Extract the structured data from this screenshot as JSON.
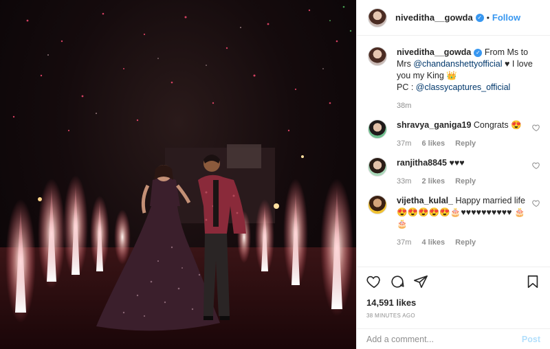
{
  "post": {
    "username": "niveditha__gowda",
    "follow_label": "Follow",
    "dot": "•",
    "caption": {
      "before": "From Ms to Mrs",
      "mention1": "@chandanshetty",
      "mention1b": "official",
      "after": "♥ I love you my King 👑",
      "pc": "PC : ",
      "mention2": "@classycaptures_official",
      "time": "38m"
    },
    "comments": [
      {
        "user": "shravya_ganiga19",
        "text": "Congrats 😍",
        "time": "37m",
        "likes": "6 likes",
        "reply": "Reply"
      },
      {
        "user": "ranjitha8845",
        "text": "♥♥♥",
        "time": "33m",
        "likes": "2 likes",
        "reply": "Reply"
      },
      {
        "user": "vijetha_kulal_",
        "text": "Happy married life 😍😍😍😍😍🎂♥♥♥♥♥♥♥♥♥♥ 🎂🎂",
        "time": "37m",
        "likes": "4 likes",
        "reply": "Reply"
      }
    ],
    "likes_count": "14,591 likes",
    "time_ago": "38 MINUTES AGO",
    "comment_placeholder": "Add a comment...",
    "post_label": "Post"
  },
  "colors": {
    "link": "#3897f0",
    "mention": "#00376b",
    "muted": "#8e8e8e"
  }
}
